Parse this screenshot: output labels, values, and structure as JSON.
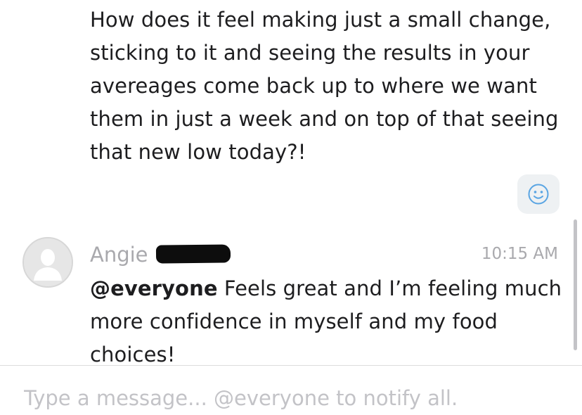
{
  "previous_message": {
    "text": "How does it feel making just a small change, sticking to it and seeing the results in your avereages come back up to where we want them in just a week and on top of that seeing that new low today?!"
  },
  "reaction": {
    "icon": "smiley-face-icon",
    "color": "#5aa5e3"
  },
  "current_message": {
    "author": "Angie",
    "time": "10:15 AM",
    "mention": "@everyone",
    "text": " Feels great and I’m feeling much more confidence in myself and my food choices!"
  },
  "composer": {
    "placeholder": "Type a message... @everyone to notify all."
  }
}
